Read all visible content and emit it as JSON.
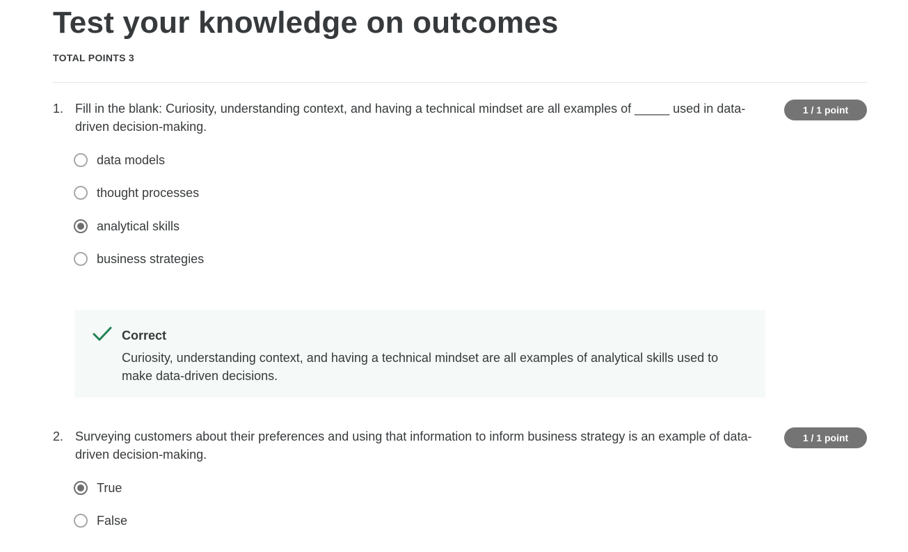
{
  "quiz": {
    "title": "Test your knowledge on outcomes",
    "total_points": "TOTAL POINTS 3"
  },
  "questions": [
    {
      "number": "1.",
      "text": "Fill in the blank: Curiosity, understanding context, and having a technical mindset are all examples of _____ used in data-driven decision-making.",
      "score": "1 / 1 point",
      "options": [
        {
          "label": "data models",
          "selected": false
        },
        {
          "label": "thought processes",
          "selected": false
        },
        {
          "label": "analytical skills",
          "selected": true
        },
        {
          "label": "business strategies",
          "selected": false
        }
      ],
      "feedback": {
        "status": "Correct",
        "icon": "checkmark-icon",
        "color": "#1f8354",
        "text": "Curiosity, understanding context, and having a technical mindset are all examples of analytical skills used to make data-driven decisions."
      }
    },
    {
      "number": "2.",
      "text": "Surveying customers about their preferences and using that information to inform business strategy is an example of data-driven decision-making.",
      "score": "1 / 1 point",
      "options": [
        {
          "label": "True",
          "selected": true
        },
        {
          "label": "False",
          "selected": false
        }
      ]
    }
  ],
  "colors": {
    "badge": "#747474",
    "text": "#373a3c",
    "feedback_bg": "#f5f9f7",
    "success": "#1f8354"
  }
}
